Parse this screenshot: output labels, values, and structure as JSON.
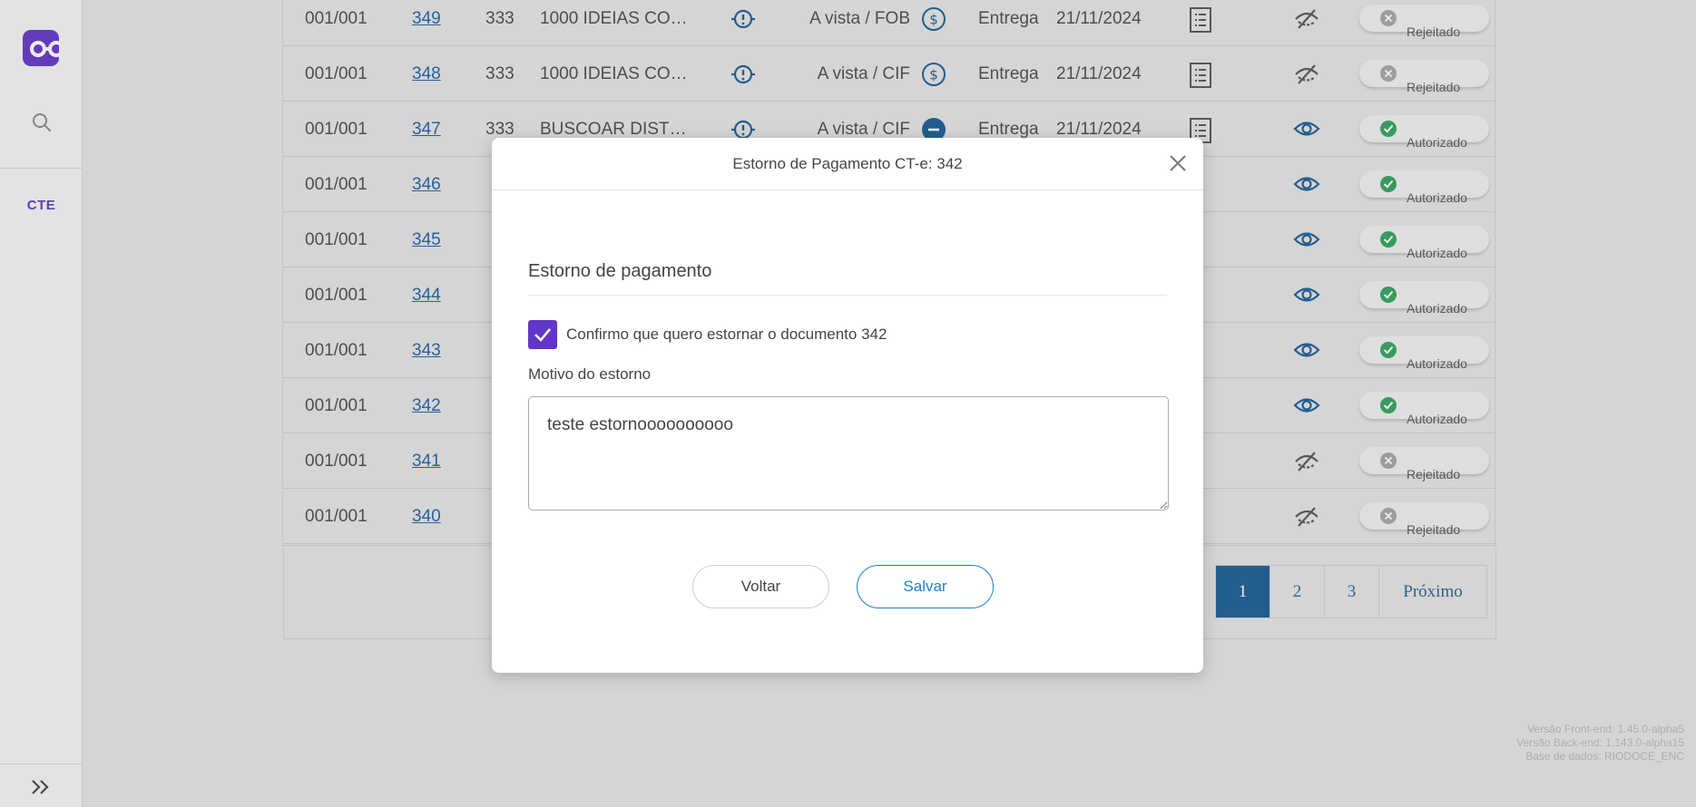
{
  "sidebar": {
    "module_label": "CTE"
  },
  "table": {
    "rows": [
      {
        "serie": "001/001",
        "numero": "349",
        "codigo": "333",
        "cliente": "1000 IDEIAS COME...",
        "pagamento": "A vista / FOB",
        "pag_icon": "dollar",
        "modalidade": "Entrega",
        "data": "21/11/2024",
        "visible": false,
        "status": "Rejeitado"
      },
      {
        "serie": "001/001",
        "numero": "348",
        "codigo": "333",
        "cliente": "1000 IDEIAS COME...",
        "pagamento": "A vista / CIF",
        "pag_icon": "dollar",
        "modalidade": "Entrega",
        "data": "21/11/2024",
        "visible": false,
        "status": "Rejeitado"
      },
      {
        "serie": "001/001",
        "numero": "347",
        "codigo": "333",
        "cliente": "BUSCOAR DISTRIB...",
        "pagamento": "A vista / CIF",
        "pag_icon": "minus",
        "modalidade": "Entrega",
        "data": "21/11/2024",
        "visible": true,
        "status": "Autorizado"
      },
      {
        "serie": "001/001",
        "numero": "346",
        "codigo": "",
        "cliente": "",
        "pagamento": "",
        "pag_icon": "",
        "modalidade": "",
        "data": "",
        "visible": true,
        "status": "Autorizado"
      },
      {
        "serie": "001/001",
        "numero": "345",
        "codigo": "",
        "cliente": "",
        "pagamento": "",
        "pag_icon": "",
        "modalidade": "",
        "data": "",
        "visible": true,
        "status": "Autorizado"
      },
      {
        "serie": "001/001",
        "numero": "344",
        "codigo": "",
        "cliente": "",
        "pagamento": "",
        "pag_icon": "",
        "modalidade": "",
        "data": "",
        "visible": true,
        "status": "Autorizado"
      },
      {
        "serie": "001/001",
        "numero": "343",
        "codigo": "",
        "cliente": "",
        "pagamento": "",
        "pag_icon": "",
        "modalidade": "",
        "data": "",
        "visible": true,
        "status": "Autorizado"
      },
      {
        "serie": "001/001",
        "numero": "342",
        "codigo": "",
        "cliente": "",
        "pagamento": "",
        "pag_icon": "",
        "modalidade": "",
        "data": "",
        "visible": true,
        "status": "Autorizado"
      },
      {
        "serie": "001/001",
        "numero": "341",
        "codigo": "",
        "cliente": "",
        "pagamento": "",
        "pag_icon": "",
        "modalidade": "",
        "data": "",
        "visible": false,
        "status": "Rejeitado"
      },
      {
        "serie": "001/001",
        "numero": "340",
        "codigo": "",
        "cliente": "",
        "pagamento": "",
        "pag_icon": "",
        "modalidade": "",
        "data": "",
        "visible": false,
        "status": "Rejeitado"
      }
    ]
  },
  "pagination": {
    "pages": [
      "1",
      "2",
      "3"
    ],
    "active": "1",
    "next_label": "Próximo"
  },
  "version": {
    "frontend": "Versão Front-end: 1.45.0-alpha5",
    "backend": "Versão Back-end: 1.143.0-alpha15",
    "database": "Base de dados: RIODOCE_ENC"
  },
  "modal": {
    "title": "Estorno de Pagamento CT-e: 342",
    "section_title": "Estorno de pagamento",
    "checkbox_checked": true,
    "checkbox_label": "Confirmo que quero estornar o documento 342",
    "reason_label": "Motivo do estorno",
    "reason_value": "teste estornoooooooooo",
    "back_label": "Voltar",
    "save_label": "Salvar"
  },
  "colors": {
    "brand": "#6236c8",
    "link": "#1d5fa6",
    "authorized": "#2fa25e",
    "rejected": "#a4a4a4",
    "pager_active": "#1a5c94",
    "save_button": "#1a7fd1"
  }
}
